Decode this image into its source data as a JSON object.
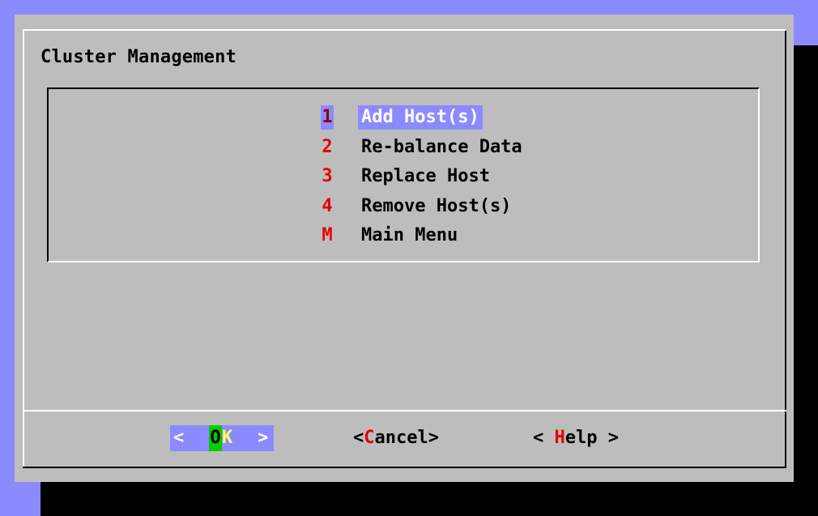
{
  "dialog": {
    "title": "Cluster Management"
  },
  "menu": {
    "items": [
      {
        "tag": "1",
        "label": "Add Host(s)",
        "selected": true
      },
      {
        "tag": "2",
        "label": "Re-balance Data",
        "selected": false
      },
      {
        "tag": "3",
        "label": "Replace Host",
        "selected": false
      },
      {
        "tag": "4",
        "label": "Remove Host(s)",
        "selected": false
      },
      {
        "tag": "M",
        "label": "Main Menu",
        "selected": false
      }
    ]
  },
  "buttons": {
    "ok": {
      "open": "<",
      "hotkey": "O",
      "rest": "K",
      "close": ">"
    },
    "cancel": {
      "open": "<",
      "hotkey": "C",
      "rest": "ancel",
      "close": ">"
    },
    "help": {
      "open": "< ",
      "hotkey": "H",
      "rest": "elp",
      "close": " >"
    }
  },
  "colors": {
    "background": "#8b8bff",
    "dialog": "#bdbdbd",
    "hotkey": "#e60000",
    "selection": "#8b8bff",
    "ok_hotkey_bg": "#00cc00",
    "ok_rest": "#ffff55"
  }
}
